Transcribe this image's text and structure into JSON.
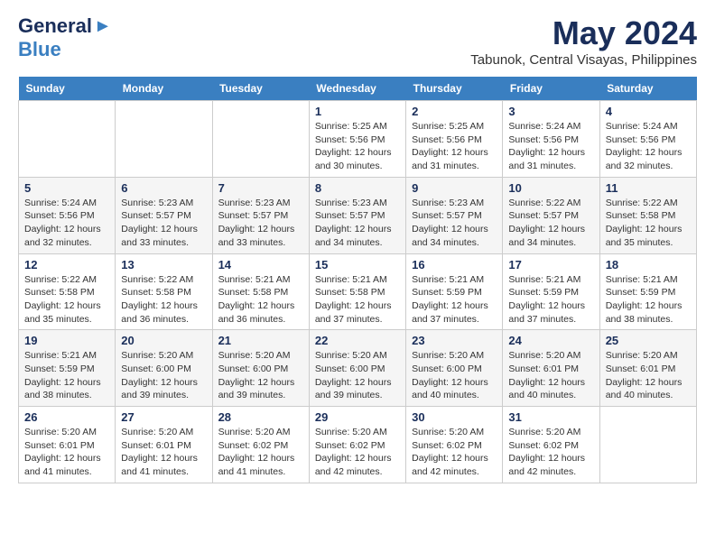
{
  "logo": {
    "general": "General",
    "blue": "Blue"
  },
  "title": "May 2024",
  "location": "Tabunok, Central Visayas, Philippines",
  "headers": [
    "Sunday",
    "Monday",
    "Tuesday",
    "Wednesday",
    "Thursday",
    "Friday",
    "Saturday"
  ],
  "weeks": [
    [
      {
        "day": "",
        "info": ""
      },
      {
        "day": "",
        "info": ""
      },
      {
        "day": "",
        "info": ""
      },
      {
        "day": "1",
        "info": "Sunrise: 5:25 AM\nSunset: 5:56 PM\nDaylight: 12 hours\nand 30 minutes."
      },
      {
        "day": "2",
        "info": "Sunrise: 5:25 AM\nSunset: 5:56 PM\nDaylight: 12 hours\nand 31 minutes."
      },
      {
        "day": "3",
        "info": "Sunrise: 5:24 AM\nSunset: 5:56 PM\nDaylight: 12 hours\nand 31 minutes."
      },
      {
        "day": "4",
        "info": "Sunrise: 5:24 AM\nSunset: 5:56 PM\nDaylight: 12 hours\nand 32 minutes."
      }
    ],
    [
      {
        "day": "5",
        "info": "Sunrise: 5:24 AM\nSunset: 5:56 PM\nDaylight: 12 hours\nand 32 minutes."
      },
      {
        "day": "6",
        "info": "Sunrise: 5:23 AM\nSunset: 5:57 PM\nDaylight: 12 hours\nand 33 minutes."
      },
      {
        "day": "7",
        "info": "Sunrise: 5:23 AM\nSunset: 5:57 PM\nDaylight: 12 hours\nand 33 minutes."
      },
      {
        "day": "8",
        "info": "Sunrise: 5:23 AM\nSunset: 5:57 PM\nDaylight: 12 hours\nand 34 minutes."
      },
      {
        "day": "9",
        "info": "Sunrise: 5:23 AM\nSunset: 5:57 PM\nDaylight: 12 hours\nand 34 minutes."
      },
      {
        "day": "10",
        "info": "Sunrise: 5:22 AM\nSunset: 5:57 PM\nDaylight: 12 hours\nand 34 minutes."
      },
      {
        "day": "11",
        "info": "Sunrise: 5:22 AM\nSunset: 5:58 PM\nDaylight: 12 hours\nand 35 minutes."
      }
    ],
    [
      {
        "day": "12",
        "info": "Sunrise: 5:22 AM\nSunset: 5:58 PM\nDaylight: 12 hours\nand 35 minutes."
      },
      {
        "day": "13",
        "info": "Sunrise: 5:22 AM\nSunset: 5:58 PM\nDaylight: 12 hours\nand 36 minutes."
      },
      {
        "day": "14",
        "info": "Sunrise: 5:21 AM\nSunset: 5:58 PM\nDaylight: 12 hours\nand 36 minutes."
      },
      {
        "day": "15",
        "info": "Sunrise: 5:21 AM\nSunset: 5:58 PM\nDaylight: 12 hours\nand 37 minutes."
      },
      {
        "day": "16",
        "info": "Sunrise: 5:21 AM\nSunset: 5:59 PM\nDaylight: 12 hours\nand 37 minutes."
      },
      {
        "day": "17",
        "info": "Sunrise: 5:21 AM\nSunset: 5:59 PM\nDaylight: 12 hours\nand 37 minutes."
      },
      {
        "day": "18",
        "info": "Sunrise: 5:21 AM\nSunset: 5:59 PM\nDaylight: 12 hours\nand 38 minutes."
      }
    ],
    [
      {
        "day": "19",
        "info": "Sunrise: 5:21 AM\nSunset: 5:59 PM\nDaylight: 12 hours\nand 38 minutes."
      },
      {
        "day": "20",
        "info": "Sunrise: 5:20 AM\nSunset: 6:00 PM\nDaylight: 12 hours\nand 39 minutes."
      },
      {
        "day": "21",
        "info": "Sunrise: 5:20 AM\nSunset: 6:00 PM\nDaylight: 12 hours\nand 39 minutes."
      },
      {
        "day": "22",
        "info": "Sunrise: 5:20 AM\nSunset: 6:00 PM\nDaylight: 12 hours\nand 39 minutes."
      },
      {
        "day": "23",
        "info": "Sunrise: 5:20 AM\nSunset: 6:00 PM\nDaylight: 12 hours\nand 40 minutes."
      },
      {
        "day": "24",
        "info": "Sunrise: 5:20 AM\nSunset: 6:01 PM\nDaylight: 12 hours\nand 40 minutes."
      },
      {
        "day": "25",
        "info": "Sunrise: 5:20 AM\nSunset: 6:01 PM\nDaylight: 12 hours\nand 40 minutes."
      }
    ],
    [
      {
        "day": "26",
        "info": "Sunrise: 5:20 AM\nSunset: 6:01 PM\nDaylight: 12 hours\nand 41 minutes."
      },
      {
        "day": "27",
        "info": "Sunrise: 5:20 AM\nSunset: 6:01 PM\nDaylight: 12 hours\nand 41 minutes."
      },
      {
        "day": "28",
        "info": "Sunrise: 5:20 AM\nSunset: 6:02 PM\nDaylight: 12 hours\nand 41 minutes."
      },
      {
        "day": "29",
        "info": "Sunrise: 5:20 AM\nSunset: 6:02 PM\nDaylight: 12 hours\nand 42 minutes."
      },
      {
        "day": "30",
        "info": "Sunrise: 5:20 AM\nSunset: 6:02 PM\nDaylight: 12 hours\nand 42 minutes."
      },
      {
        "day": "31",
        "info": "Sunrise: 5:20 AM\nSunset: 6:02 PM\nDaylight: 12 hours\nand 42 minutes."
      },
      {
        "day": "",
        "info": ""
      }
    ]
  ]
}
